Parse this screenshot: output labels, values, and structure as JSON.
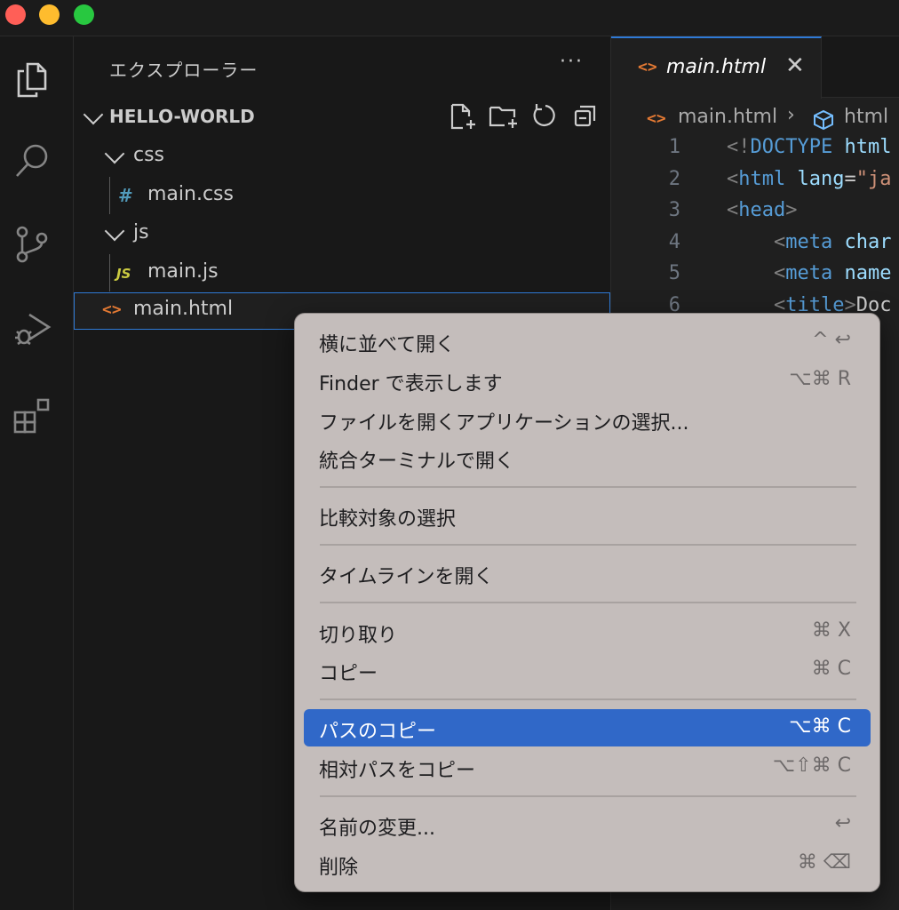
{
  "window": {
    "traffic_lights": [
      "close",
      "minimize",
      "zoom"
    ]
  },
  "activity_bar": {
    "icons": [
      "files-icon",
      "search-icon",
      "source-control-icon",
      "run-debug-icon",
      "extensions-icon"
    ]
  },
  "sidebar": {
    "title": "エクスプローラー",
    "more": "···",
    "folder": "HELLO-WORLD",
    "tree": [
      {
        "name": "css",
        "type": "folder"
      },
      {
        "name": "main.css",
        "type": "file",
        "icon": "#"
      },
      {
        "name": "js",
        "type": "folder"
      },
      {
        "name": "main.js",
        "type": "file",
        "icon": "JS"
      },
      {
        "name": "main.html",
        "type": "file",
        "icon": "<>"
      }
    ]
  },
  "editor": {
    "tab_label": "main.html",
    "tab_close": "✕",
    "breadcrumb": {
      "file": "main.html",
      "symbol": "html"
    },
    "code_lines": [
      {
        "num": "1",
        "text": "<!DOCTYPE html"
      },
      {
        "num": "2",
        "text": "<html lang=\"ja"
      },
      {
        "num": "3",
        "text": "<head>"
      },
      {
        "num": "4",
        "text": "    <meta char"
      },
      {
        "num": "5",
        "text": "    <meta name"
      },
      {
        "num": "6",
        "text": "    <title>Doc"
      }
    ]
  },
  "context_menu": {
    "items": [
      {
        "label": "横に並べて開く",
        "shortcut": "^ ↩"
      },
      {
        "label": "Finder で表示します",
        "shortcut": "⌥⌘ R"
      },
      {
        "label": "ファイルを開くアプリケーションの選択...",
        "shortcut": ""
      },
      {
        "label": "統合ターミナルで開く",
        "shortcut": ""
      },
      {
        "label": "比較対象の選択",
        "shortcut": ""
      },
      {
        "label": "タイムラインを開く",
        "shortcut": ""
      },
      {
        "label": "切り取り",
        "shortcut": "⌘ X"
      },
      {
        "label": "コピー",
        "shortcut": "⌘ C"
      },
      {
        "label": "パスのコピー",
        "shortcut": "⌥⌘ C",
        "highlighted": true
      },
      {
        "label": "相対パスをコピー",
        "shortcut": "⌥⇧⌘ C"
      },
      {
        "label": "名前の変更...",
        "shortcut": "↩"
      },
      {
        "label": "削除",
        "shortcut": "⌘ ⌫"
      }
    ]
  },
  "colors": {
    "accent": "#2f7ad6",
    "menu_highlight": "#3068c8",
    "menu_bg": "#c4bdbb"
  }
}
